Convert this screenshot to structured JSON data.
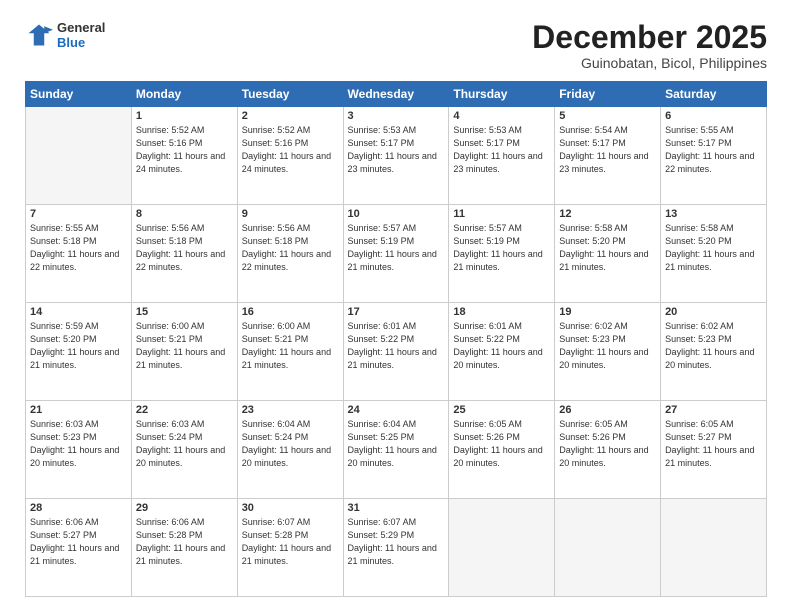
{
  "header": {
    "logo_general": "General",
    "logo_blue": "Blue",
    "main_title": "December 2025",
    "subtitle": "Guinobatan, Bicol, Philippines"
  },
  "weekdays": [
    "Sunday",
    "Monday",
    "Tuesday",
    "Wednesday",
    "Thursday",
    "Friday",
    "Saturday"
  ],
  "weeks": [
    [
      {
        "day": "",
        "detail": ""
      },
      {
        "day": "1",
        "detail": "Sunrise: 5:52 AM\nSunset: 5:16 PM\nDaylight: 11 hours\nand 24 minutes."
      },
      {
        "day": "2",
        "detail": "Sunrise: 5:52 AM\nSunset: 5:16 PM\nDaylight: 11 hours\nand 24 minutes."
      },
      {
        "day": "3",
        "detail": "Sunrise: 5:53 AM\nSunset: 5:17 PM\nDaylight: 11 hours\nand 23 minutes."
      },
      {
        "day": "4",
        "detail": "Sunrise: 5:53 AM\nSunset: 5:17 PM\nDaylight: 11 hours\nand 23 minutes."
      },
      {
        "day": "5",
        "detail": "Sunrise: 5:54 AM\nSunset: 5:17 PM\nDaylight: 11 hours\nand 23 minutes."
      },
      {
        "day": "6",
        "detail": "Sunrise: 5:55 AM\nSunset: 5:17 PM\nDaylight: 11 hours\nand 22 minutes."
      }
    ],
    [
      {
        "day": "7",
        "detail": "Sunrise: 5:55 AM\nSunset: 5:18 PM\nDaylight: 11 hours\nand 22 minutes."
      },
      {
        "day": "8",
        "detail": "Sunrise: 5:56 AM\nSunset: 5:18 PM\nDaylight: 11 hours\nand 22 minutes."
      },
      {
        "day": "9",
        "detail": "Sunrise: 5:56 AM\nSunset: 5:18 PM\nDaylight: 11 hours\nand 22 minutes."
      },
      {
        "day": "10",
        "detail": "Sunrise: 5:57 AM\nSunset: 5:19 PM\nDaylight: 11 hours\nand 21 minutes."
      },
      {
        "day": "11",
        "detail": "Sunrise: 5:57 AM\nSunset: 5:19 PM\nDaylight: 11 hours\nand 21 minutes."
      },
      {
        "day": "12",
        "detail": "Sunrise: 5:58 AM\nSunset: 5:20 PM\nDaylight: 11 hours\nand 21 minutes."
      },
      {
        "day": "13",
        "detail": "Sunrise: 5:58 AM\nSunset: 5:20 PM\nDaylight: 11 hours\nand 21 minutes."
      }
    ],
    [
      {
        "day": "14",
        "detail": "Sunrise: 5:59 AM\nSunset: 5:20 PM\nDaylight: 11 hours\nand 21 minutes."
      },
      {
        "day": "15",
        "detail": "Sunrise: 6:00 AM\nSunset: 5:21 PM\nDaylight: 11 hours\nand 21 minutes."
      },
      {
        "day": "16",
        "detail": "Sunrise: 6:00 AM\nSunset: 5:21 PM\nDaylight: 11 hours\nand 21 minutes."
      },
      {
        "day": "17",
        "detail": "Sunrise: 6:01 AM\nSunset: 5:22 PM\nDaylight: 11 hours\nand 21 minutes."
      },
      {
        "day": "18",
        "detail": "Sunrise: 6:01 AM\nSunset: 5:22 PM\nDaylight: 11 hours\nand 20 minutes."
      },
      {
        "day": "19",
        "detail": "Sunrise: 6:02 AM\nSunset: 5:23 PM\nDaylight: 11 hours\nand 20 minutes."
      },
      {
        "day": "20",
        "detail": "Sunrise: 6:02 AM\nSunset: 5:23 PM\nDaylight: 11 hours\nand 20 minutes."
      }
    ],
    [
      {
        "day": "21",
        "detail": "Sunrise: 6:03 AM\nSunset: 5:23 PM\nDaylight: 11 hours\nand 20 minutes."
      },
      {
        "day": "22",
        "detail": "Sunrise: 6:03 AM\nSunset: 5:24 PM\nDaylight: 11 hours\nand 20 minutes."
      },
      {
        "day": "23",
        "detail": "Sunrise: 6:04 AM\nSunset: 5:24 PM\nDaylight: 11 hours\nand 20 minutes."
      },
      {
        "day": "24",
        "detail": "Sunrise: 6:04 AM\nSunset: 5:25 PM\nDaylight: 11 hours\nand 20 minutes."
      },
      {
        "day": "25",
        "detail": "Sunrise: 6:05 AM\nSunset: 5:26 PM\nDaylight: 11 hours\nand 20 minutes."
      },
      {
        "day": "26",
        "detail": "Sunrise: 6:05 AM\nSunset: 5:26 PM\nDaylight: 11 hours\nand 20 minutes."
      },
      {
        "day": "27",
        "detail": "Sunrise: 6:05 AM\nSunset: 5:27 PM\nDaylight: 11 hours\nand 21 minutes."
      }
    ],
    [
      {
        "day": "28",
        "detail": "Sunrise: 6:06 AM\nSunset: 5:27 PM\nDaylight: 11 hours\nand 21 minutes."
      },
      {
        "day": "29",
        "detail": "Sunrise: 6:06 AM\nSunset: 5:28 PM\nDaylight: 11 hours\nand 21 minutes."
      },
      {
        "day": "30",
        "detail": "Sunrise: 6:07 AM\nSunset: 5:28 PM\nDaylight: 11 hours\nand 21 minutes."
      },
      {
        "day": "31",
        "detail": "Sunrise: 6:07 AM\nSunset: 5:29 PM\nDaylight: 11 hours\nand 21 minutes."
      },
      {
        "day": "",
        "detail": ""
      },
      {
        "day": "",
        "detail": ""
      },
      {
        "day": "",
        "detail": ""
      }
    ]
  ]
}
